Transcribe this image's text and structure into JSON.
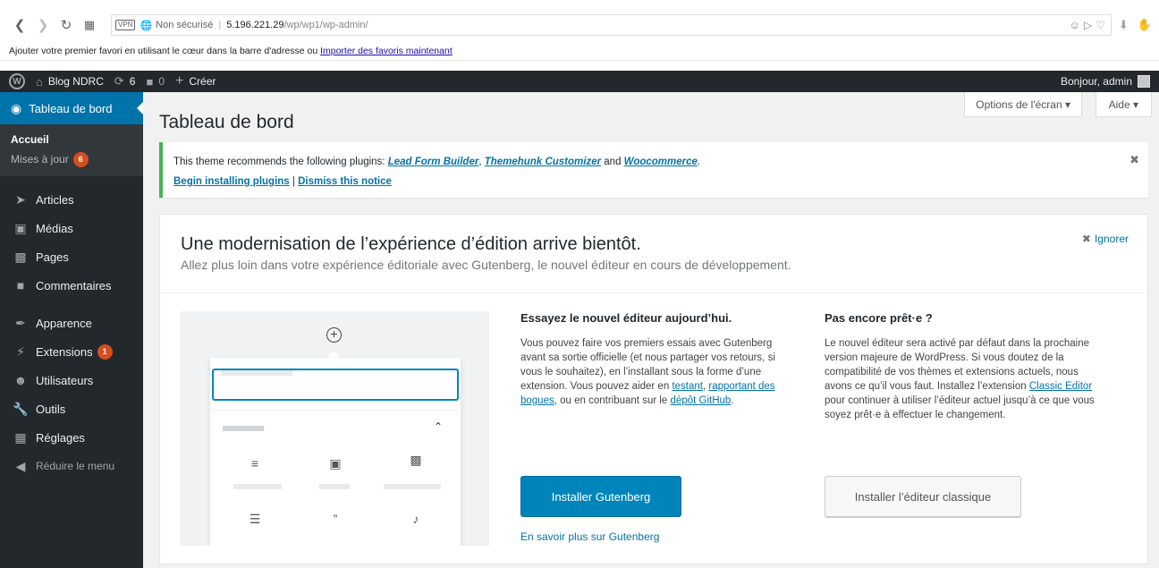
{
  "browser": {
    "vpn_label": "VPN",
    "security_label": "Non sécurisé",
    "host": "5.196.221.29",
    "path": "/wp/wp1/wp-admin/",
    "favorites_prompt": "Ajouter votre premier favori en utilisant le cœur dans la barre d'adresse ou",
    "favorites_link": "Importer des favoris maintenant"
  },
  "adminbar": {
    "site_name": "Blog NDRC",
    "updates_count": "6",
    "comments_count": "0",
    "new_label": "Créer",
    "greeting": "Bonjour, admin"
  },
  "sidebar": {
    "current": "Tableau de bord",
    "submenu": [
      {
        "label": "Accueil"
      },
      {
        "label": "Mises à jour",
        "badge": "6"
      }
    ],
    "items": [
      {
        "label": "Articles",
        "icon": "pin-icon"
      },
      {
        "label": "Médias",
        "icon": "media-icon"
      },
      {
        "label": "Pages",
        "icon": "pages-icon"
      },
      {
        "label": "Commentaires",
        "icon": "comments-icon"
      },
      {
        "label": "Apparence",
        "icon": "appearance-icon"
      },
      {
        "label": "Extensions",
        "icon": "plugins-icon",
        "badge": "1"
      },
      {
        "label": "Utilisateurs",
        "icon": "users-icon"
      },
      {
        "label": "Outils",
        "icon": "tools-icon"
      },
      {
        "label": "Réglages",
        "icon": "settings-icon"
      }
    ],
    "collapse_label": "Réduire le menu"
  },
  "main": {
    "screen_options": "Options de l'écran",
    "help": "Aide",
    "title": "Tableau de bord",
    "notice": {
      "text_before": "This theme recommends the following plugins:",
      "plugin1": "Lead Form Builder",
      "plugin2": "Themehunk Customizer",
      "and": "and",
      "plugin3": "Woocommerce",
      "begin": "Begin installing plugins",
      "separator": "|",
      "dismiss": "Dismiss this notice"
    },
    "panel": {
      "heading": "Une modernisation de l’expérience d’édition arrive bientôt.",
      "subheading": "Allez plus loin dans votre expérience éditoriale avec Gutenberg, le nouvel éditeur en cours de développement.",
      "ignore": "Ignorer",
      "col1": {
        "title": "Essayez le nouvel éditeur aujourd’hui.",
        "text_a": "Vous pouvez faire vos premiers essais avec Gutenberg avant sa sortie officielle (et nous partager vos retours, si vous le souhaitez), en l’installant sous la forme d’une extension. Vous pouvez aider en",
        "link_testing": "testant",
        "link_reporting": "rapportant des bogues",
        "text_b": ", ou en contribuant sur le",
        "link_github": "dépôt GitHub",
        "button": "Installer Gutenberg",
        "learn_more": "En savoir plus sur Gutenberg"
      },
      "col2": {
        "title": "Pas encore prêt·e ?",
        "text_a": "Le nouvel éditeur sera activé par défaut dans la prochaine version majeure de WordPress. Si vous doutez de la compatibilité de vos thèmes et extensions actuels, nous avons ce qu’il vous faut. Installez l’extension",
        "link_classic": "Classic Editor",
        "text_b": "pour continuer à utiliser l’éditeur actuel jusqu’à ce que vous soyez prêt·e à effectuer le changement.",
        "button": "Installer l’éditeur classique"
      }
    }
  },
  "colors": {
    "admin_dark": "#23282d",
    "primary_blue": "#0085ba",
    "link_blue": "#0073aa",
    "notice_green": "#46b450",
    "badge_orange": "#d54e21"
  }
}
